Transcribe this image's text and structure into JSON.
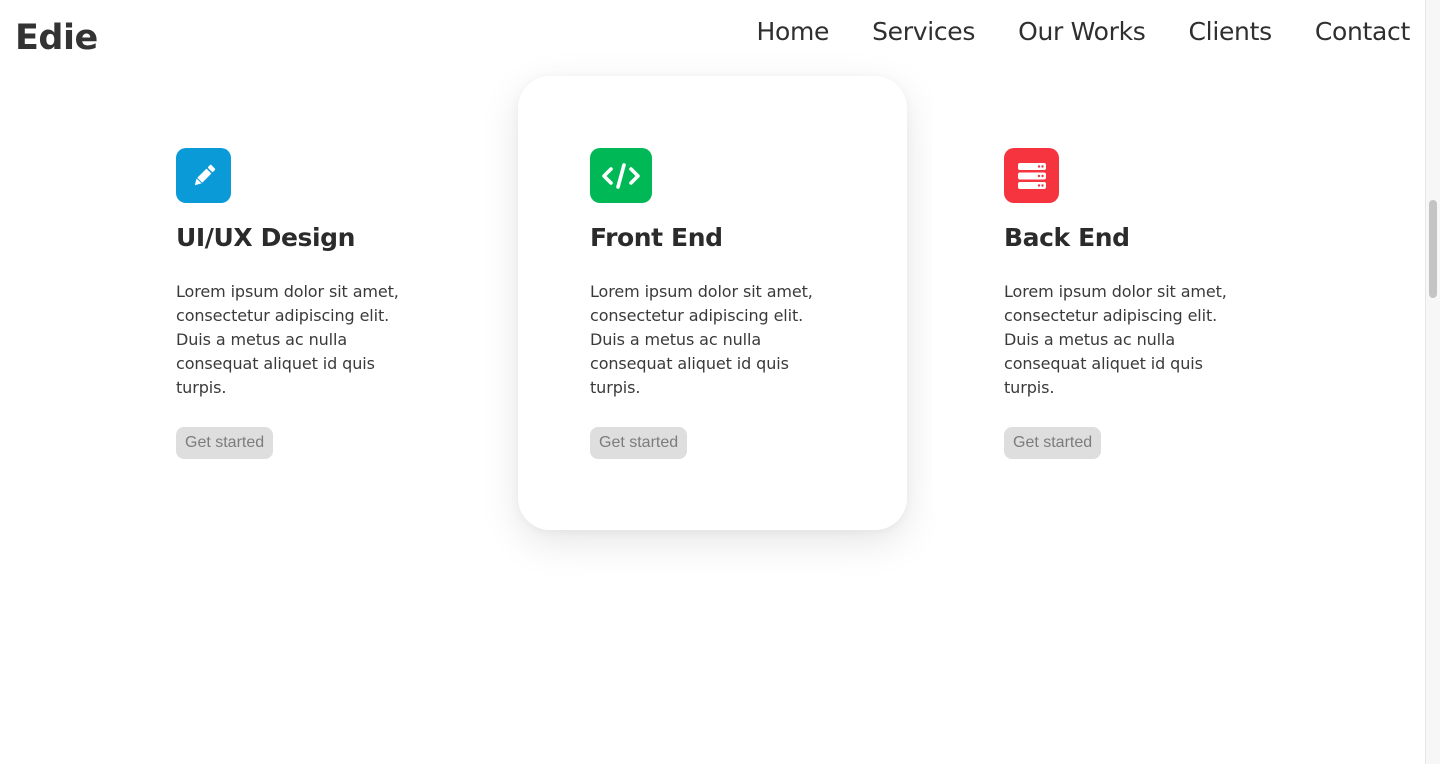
{
  "brand": {
    "name": "Edie"
  },
  "nav": {
    "items": [
      {
        "label": "Home"
      },
      {
        "label": "Services"
      },
      {
        "label": "Our Works"
      },
      {
        "label": "Clients"
      },
      {
        "label": "Contact"
      }
    ]
  },
  "services": [
    {
      "icon": "pencil-icon",
      "icon_color": "#0a9ad8",
      "title": "UI/UX Design",
      "description": "Lorem ipsum dolor sit amet, consectetur adipiscing elit. Duis a metus ac nulla consequat aliquet id quis turpis.",
      "cta": "Get started"
    },
    {
      "icon": "code-icon",
      "icon_color": "#00b956",
      "title": "Front End",
      "description": "Lorem ipsum dolor sit amet, consectetur adipiscing elit. Duis a metus ac nulla consequat aliquet id quis turpis.",
      "cta": "Get started"
    },
    {
      "icon": "server-icon",
      "icon_color": "#f5343f",
      "title": "Back End",
      "description": "Lorem ipsum dolor sit amet, consectetur adipiscing elit. Duis a metus ac nulla consequat aliquet id quis turpis.",
      "cta": "Get started"
    }
  ],
  "colors": {
    "cta_background": "#dedede",
    "cta_text": "#7c7c7c",
    "text": "#2f2f2f"
  }
}
